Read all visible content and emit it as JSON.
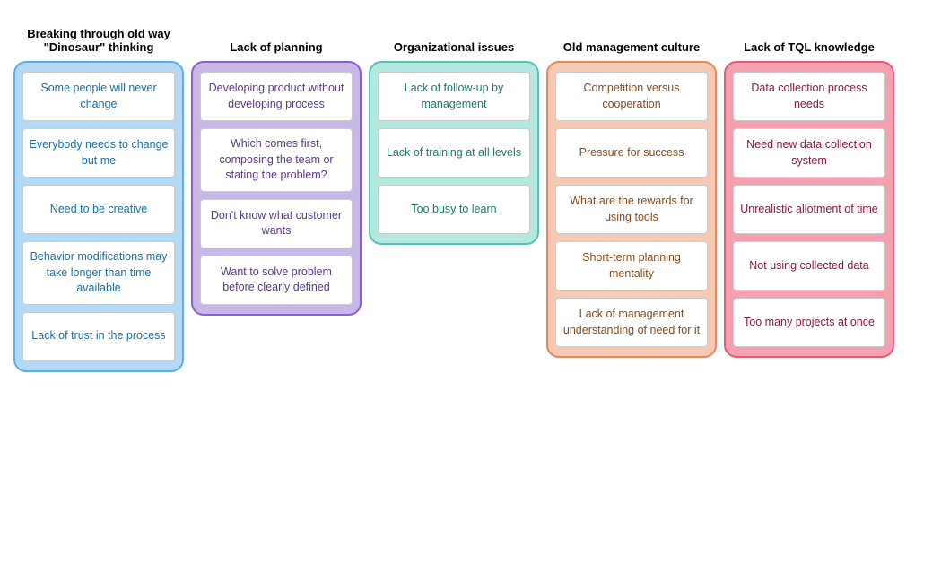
{
  "columns": [
    {
      "id": "col-blue",
      "colorClass": "col-blue",
      "header": "Breaking through old way \"Dinosaur\" thinking",
      "cards": [
        "Some people will never change",
        "Everybody needs to change but me",
        "Need to be creative",
        "Behavior modifications may take longer than time available",
        "Lack of trust in the process"
      ]
    },
    {
      "id": "col-purple",
      "colorClass": "col-purple",
      "header": "Lack of planning",
      "cards": [
        "Developing product without developing process",
        "Which comes first, composing the team or stating the problem?",
        "Don't know what customer wants",
        "Want to solve problem before clearly defined"
      ]
    },
    {
      "id": "col-teal",
      "colorClass": "col-teal",
      "header": "Organizational issues",
      "cards": [
        "Lack of follow-up by management",
        "Lack of training at all levels",
        "Too busy to learn"
      ]
    },
    {
      "id": "col-peach",
      "colorClass": "col-peach",
      "header": "Old management culture",
      "cards": [
        "Competition versus cooperation",
        "Pressure for success",
        "What are the rewards for using tools",
        "Short-term planning mentality",
        "Lack of management understanding of need for it"
      ]
    },
    {
      "id": "col-pink",
      "colorClass": "col-pink",
      "header": "Lack of TQL knowledge",
      "cards": [
        "Data collection process needs",
        "Need new data collection system",
        "Unrealistic allotment of time",
        "Not using collected data",
        "Too many projects at once"
      ]
    }
  ]
}
